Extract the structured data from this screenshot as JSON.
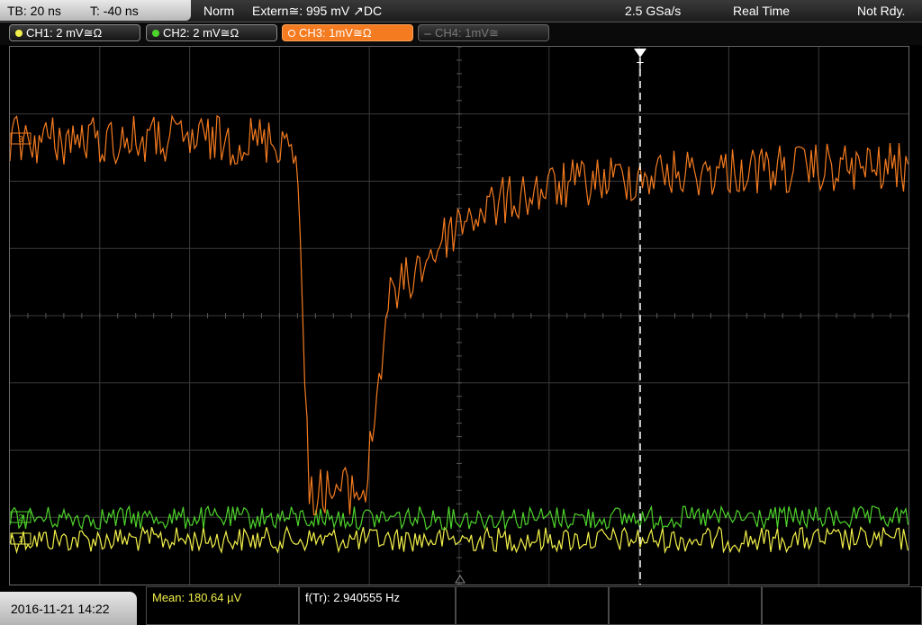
{
  "topbar": {
    "timebase": "TB: 20 ns",
    "trigger_time": "T: -40 ns",
    "mode": "Norm",
    "trigger": "Extern≅: 995 mV ↗DC",
    "sample_rate": "2.5 GSa/s",
    "acq_mode": "Real Time",
    "status": "Not Rdy."
  },
  "channels": [
    {
      "label": "CH1: 2 mV≅Ω",
      "color": "#f2f04a"
    },
    {
      "label": "CH2: 2 mV≅Ω",
      "color": "#4ed32c"
    },
    {
      "label": "CH3: 1mV≅Ω",
      "color": "#f47b20"
    },
    {
      "label": "CH4: 1mV≅",
      "color": "#6a6a6a"
    }
  ],
  "screen": {
    "trigger_marker": "T",
    "ch3_ref": "3",
    "ch2_ref": "2",
    "ch1_ref": "1"
  },
  "colors": {
    "ch1": "#f2f04a",
    "ch2": "#4ed32c",
    "ch3": "#f47b20",
    "grid": "#3a3a3a",
    "trigger_line": "#ffffff"
  },
  "bottom": {
    "datetime": "2016-11-21 14:22",
    "mean": "Mean: 180.64 µV",
    "freq": "f(Tr): 2.940555 Hz",
    "mean_color": "#f2f04a"
  }
}
